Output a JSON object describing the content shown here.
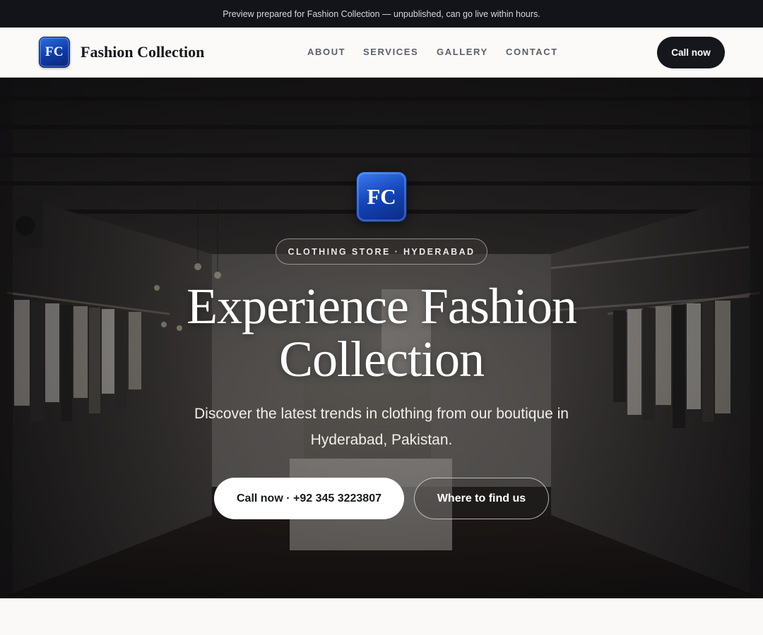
{
  "banner": {
    "text": "Preview prepared for Fashion Collection — unpublished, can go live within hours."
  },
  "header": {
    "logo_text": "FC",
    "brand_name": "Fashion Collection",
    "nav": [
      {
        "label": "ABOUT"
      },
      {
        "label": "SERVICES"
      },
      {
        "label": "GALLERY"
      },
      {
        "label": "CONTACT"
      }
    ],
    "cta_label": "Call now"
  },
  "hero": {
    "logo_text": "FC",
    "eyebrow": "CLOTHING STORE · HYDERABAD",
    "title": "Experience Fashion Collection",
    "subtitle": "Discover the latest trends in clothing from our boutique in Hyderabad, Pakistan.",
    "primary_cta": "Call now · +92 345 3223807",
    "secondary_cta": "Where to find us",
    "background": "clothing-store-interior-photo"
  },
  "colors": {
    "topbar": "#121419",
    "dark_button": "#15171c",
    "logo_blue": "#1444b8",
    "page_bg": "#faf9f7"
  }
}
